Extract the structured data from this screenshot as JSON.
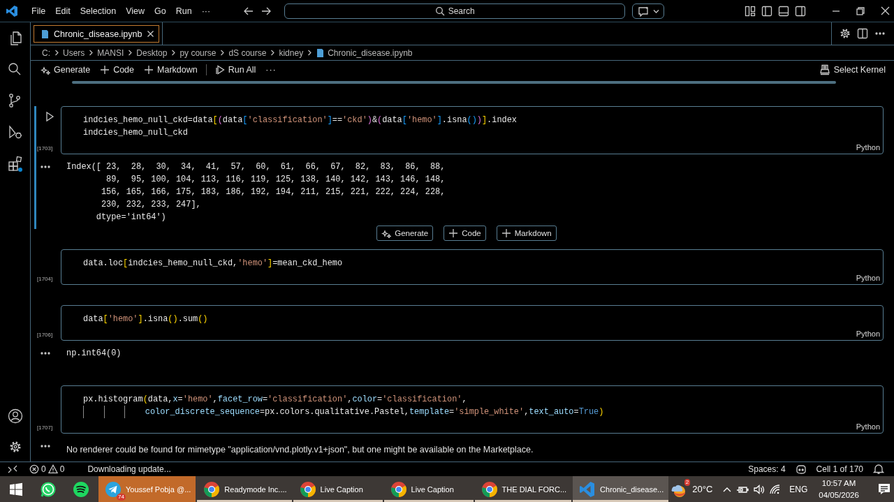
{
  "title_bar": {
    "menu": [
      "File",
      "Edit",
      "Selection",
      "View",
      "Go",
      "Run",
      "···"
    ],
    "search": {
      "label": "Search"
    }
  },
  "tabs": [
    {
      "label": "Chronic_disease.ipynb",
      "selected": true
    }
  ],
  "breadcrumb": [
    "C:",
    "Users",
    "MANSI",
    "Desktop",
    "py course",
    "dS course",
    "kidney",
    "Chronic_disease.ipynb"
  ],
  "toolbar": {
    "items": [
      {
        "kind": "generate",
        "label": "Generate"
      },
      {
        "kind": "add",
        "label": "Code"
      },
      {
        "kind": "add",
        "label": "Markdown"
      },
      {
        "kind": "run",
        "label": "Run All"
      },
      {
        "kind": "more",
        "label": "···"
      }
    ],
    "kernel": "Select Kernel"
  },
  "cells": [
    {
      "count": "[1703]",
      "language": "Python",
      "selected": true,
      "lines": [
        {
          "indented": false,
          "tokens": [
            {
              "kind": "text",
              "text": "indcies_hemo_null_ckd=data"
            },
            {
              "kind": "bracket1",
              "text": "["
            },
            {
              "kind": "bracket2",
              "text": "("
            },
            {
              "kind": "text",
              "text": "data"
            },
            {
              "kind": "bracket3",
              "text": "["
            },
            {
              "kind": "string",
              "text": "'classification'"
            },
            {
              "kind": "bracket3",
              "text": "]"
            },
            {
              "kind": "text",
              "text": "=="
            },
            {
              "kind": "string",
              "text": "'ckd'"
            },
            {
              "kind": "bracket2",
              "text": ")"
            },
            {
              "kind": "text",
              "text": "&"
            },
            {
              "kind": "bracket2",
              "text": "("
            },
            {
              "kind": "text",
              "text": "data"
            },
            {
              "kind": "bracket3",
              "text": "["
            },
            {
              "kind": "string",
              "text": "'hemo'"
            },
            {
              "kind": "bracket3",
              "text": "]"
            },
            {
              "kind": "text",
              "text": ".isna"
            },
            {
              "kind": "bracket3",
              "text": "()"
            },
            {
              "kind": "bracket2",
              "text": ")"
            },
            {
              "kind": "bracket1",
              "text": "]"
            },
            {
              "kind": "text",
              "text": ".index"
            }
          ]
        },
        {
          "indented": false,
          "tokens": [
            {
              "kind": "text",
              "text": "indcies_hemo_null_ckd"
            }
          ]
        }
      ],
      "output": {
        "kind": "mono",
        "lines": [
          "Index([ 23,  28,  30,  34,  41,  57,  60,  61,  66,  67,  82,  83,  86,  88,",
          "        89,  95, 100, 104, 113, 116, 119, 125, 138, 140, 142, 143, 146, 148,",
          "       156, 165, 166, 175, 183, 186, 192, 194, 211, 215, 221, 222, 224, 228,",
          "       230, 232, 233, 247],",
          "      dtype='int64')"
        ]
      },
      "insert_bar": [
        {
          "kind": "generate",
          "label": "Generate"
        },
        {
          "kind": "add",
          "label": "Code"
        },
        {
          "kind": "add",
          "label": "Markdown"
        }
      ]
    },
    {
      "count": "[1704]",
      "language": "Python",
      "selected": false,
      "lines": [
        {
          "indented": false,
          "tokens": [
            {
              "kind": "text",
              "text": "data.loc"
            },
            {
              "kind": "bracket1",
              "text": "["
            },
            {
              "kind": "text",
              "text": "indcies_hemo_null_ckd,"
            },
            {
              "kind": "string",
              "text": "'hemo'"
            },
            {
              "kind": "bracket1",
              "text": "]"
            },
            {
              "kind": "text",
              "text": "=mean_ckd_hemo"
            }
          ]
        }
      ]
    },
    {
      "count": "[1706]",
      "language": "Python",
      "selected": false,
      "lines": [
        {
          "indented": false,
          "tokens": [
            {
              "kind": "text",
              "text": "data"
            },
            {
              "kind": "bracket1",
              "text": "["
            },
            {
              "kind": "string",
              "text": "'hemo'"
            },
            {
              "kind": "bracket1",
              "text": "]"
            },
            {
              "kind": "text",
              "text": ".isna"
            },
            {
              "kind": "bracket1",
              "text": "()"
            },
            {
              "kind": "text",
              "text": ".sum"
            },
            {
              "kind": "bracket1",
              "text": "()"
            }
          ]
        }
      ],
      "output": {
        "kind": "mono",
        "lines": [
          "np.int64(0)"
        ]
      }
    },
    {
      "count": "[1707]",
      "language": "Python",
      "selected": false,
      "lines": [
        {
          "indented": false,
          "tokens": [
            {
              "kind": "text",
              "text": "px.histogram"
            },
            {
              "kind": "bracket1",
              "text": "("
            },
            {
              "kind": "text",
              "text": "data,"
            },
            {
              "kind": "param",
              "text": "x"
            },
            {
              "kind": "text",
              "text": "="
            },
            {
              "kind": "string",
              "text": "'hemo'"
            },
            {
              "kind": "text",
              "text": ","
            },
            {
              "kind": "param",
              "text": "facet_row"
            },
            {
              "kind": "text",
              "text": "="
            },
            {
              "kind": "string",
              "text": "'classification'"
            },
            {
              "kind": "text",
              "text": ","
            },
            {
              "kind": "param",
              "text": "color"
            },
            {
              "kind": "text",
              "text": "="
            },
            {
              "kind": "string",
              "text": "'classification'"
            },
            {
              "kind": "text",
              "text": ","
            }
          ]
        },
        {
          "indented": true,
          "tokens": [
            {
              "kind": "param",
              "text": "color_discrete_sequence"
            },
            {
              "kind": "text",
              "text": "=px.colors.qualitative.Pastel,"
            },
            {
              "kind": "param",
              "text": "template"
            },
            {
              "kind": "text",
              "text": "="
            },
            {
              "kind": "string",
              "text": "'simple_white'"
            },
            {
              "kind": "text",
              "text": ","
            },
            {
              "kind": "param",
              "text": "text_auto"
            },
            {
              "kind": "text",
              "text": "="
            },
            {
              "kind": "const",
              "text": "True"
            },
            {
              "kind": "bracket1",
              "text": ")"
            }
          ]
        }
      ],
      "output": {
        "kind": "message",
        "lines": [
          "No renderer could be found for mimetype \"application/vnd.plotly.v1+json\", but one might be available on the Marketplace."
        ]
      }
    }
  ],
  "status_bar": {
    "errors": "0",
    "warnings": "0",
    "message": "Downloading update...",
    "indentation": "Spaces: 4",
    "position": "Cell 1 of 170"
  },
  "taskbar": {
    "apps": [
      {
        "kind": "chat",
        "active": false,
        "attention": false,
        "running": false
      },
      {
        "kind": "music",
        "active": false,
        "attention": false,
        "running": false
      },
      {
        "kind": "messenger",
        "label": "Youssef Pobja @...",
        "badge": "74",
        "active": false,
        "attention": true,
        "running": true
      },
      {
        "kind": "browser",
        "label": "Readymode Inc....",
        "active": false,
        "attention": false,
        "running": true
      },
      {
        "kind": "browser",
        "label": "Live Caption",
        "active": false,
        "attention": false,
        "running": true
      },
      {
        "kind": "browser",
        "label": "Live Caption",
        "active": false,
        "attention": false,
        "running": true
      },
      {
        "kind": "browser",
        "label": "THE DIAL FORC...",
        "active": false,
        "attention": false,
        "running": true
      },
      {
        "kind": "editor",
        "label": "Chronic_disease...",
        "active": true,
        "attention": false,
        "running": true
      }
    ],
    "weather": {
      "temperature": "20°C",
      "badge": "2"
    },
    "language": "ENG",
    "time": "10:57 AM",
    "date": "04/05/2026"
  }
}
